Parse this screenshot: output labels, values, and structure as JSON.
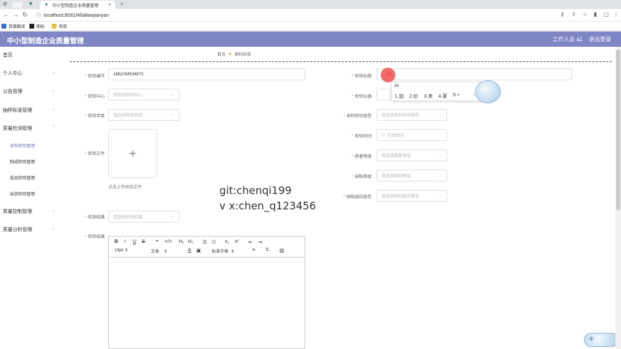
{
  "browser": {
    "tab_title": "中小型制造企业质量管理",
    "url": "localhost:8081/#/lailiaojianyan",
    "bookmarks": [
      "百度翻译",
      "图标",
      "项目"
    ]
  },
  "header": {
    "app_title": "中小型制造企业质量管理",
    "user_label": "工作人员 a1",
    "logout_label": "退出登录"
  },
  "sidebar": {
    "home": "首页",
    "items": [
      {
        "label": "个人中心"
      },
      {
        "label": "公告管理"
      },
      {
        "label": "抽样标准管理"
      },
      {
        "label": "质量检测管理"
      },
      {
        "label": "质量控制管理"
      },
      {
        "label": "质量分析管理"
      }
    ],
    "subitems": [
      {
        "label": "来料检验管理",
        "active": true
      },
      {
        "label": "制成检验管理"
      },
      {
        "label": "成品检验管理"
      },
      {
        "label": "出货检验管理"
      }
    ]
  },
  "breadcrumb": {
    "home": "首页",
    "current": "来料检验"
  },
  "form": {
    "left": {
      "code_label": "检验编号",
      "code_value": "1681094534972",
      "center_label": "检验中心",
      "center_placeholder": "请选择检验中心",
      "item_label": "检验项目",
      "item_placeholder": "请选择检验项目",
      "file_label": "检验文件",
      "file_hint": "点击上传检验文件",
      "result_label": "检测结果",
      "result_placeholder": "请选择检测结果",
      "detail_label": "检验结果"
    },
    "right": {
      "title_label": "检验标题",
      "title_value": "jia",
      "instrument_label": "检验仪器",
      "type_label": "来料检验类型",
      "type_placeholder": "请选择来料检验类型",
      "time_label": "检验时间",
      "time_placeholder": "检验时间",
      "grade_label": "质量等级",
      "grade_placeholder": "请选择质量等级",
      "defect_label": "缺陷等级",
      "defect_placeholder": "请选择缺陷等级",
      "cause_label": "缺陷原因类型",
      "cause_placeholder": "请选择缺陷原因类型"
    }
  },
  "editor": {
    "font_size": "14px",
    "block_type": "文本",
    "font_family": "标准字体"
  },
  "ime": {
    "pinyin": "jia",
    "candidates": [
      "1.加",
      "2.价",
      "3.夹",
      "4.家",
      "5.+"
    ]
  },
  "watermark": {
    "line1": "git:chenqi199",
    "line2": "v x:chen_q123456"
  },
  "ime_corner": "中"
}
